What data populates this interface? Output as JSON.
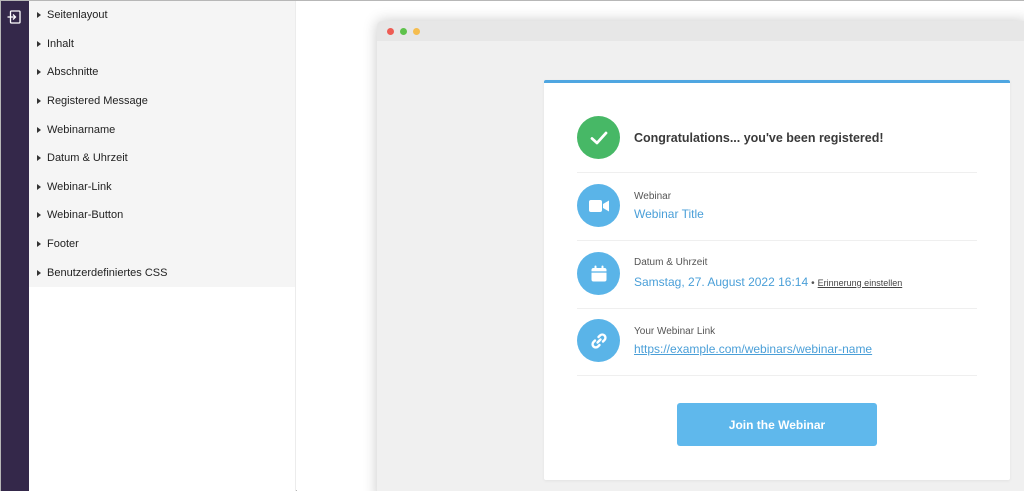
{
  "sidebar": {
    "items": [
      {
        "label": "Seitenlayout"
      },
      {
        "label": "Inhalt"
      },
      {
        "label": "Abschnitte"
      },
      {
        "label": "Registered Message"
      },
      {
        "label": "Webinarname"
      },
      {
        "label": "Datum & Uhrzeit"
      },
      {
        "label": "Webinar-Link"
      },
      {
        "label": "Webinar-Button"
      },
      {
        "label": "Footer"
      },
      {
        "label": "Benutzerdefiniertes CSS"
      }
    ]
  },
  "preview": {
    "confirmation": {
      "headline": "Congratulations... you've been registered!",
      "icon": "check-icon"
    },
    "webinar": {
      "label": "Webinar",
      "value": "Webinar Title",
      "icon": "video-camera-icon"
    },
    "datetime": {
      "label": "Datum & Uhrzeit",
      "value": "Samstag, 27. August 2022 16:14",
      "separator": "•",
      "reminder": "Erinnerung einstellen",
      "icon": "calendar-icon"
    },
    "link": {
      "label": "Your Webinar Link",
      "value": "https://example.com/webinars/webinar-name",
      "icon": "link-icon"
    },
    "join_button": {
      "label": "Join the Webinar"
    }
  },
  "colors": {
    "rail": "#34284a",
    "accent": "#4fa6e1",
    "success": "#47b866",
    "button": "#5fb8ec",
    "dot_red": "#ee5c54",
    "dot_yellow": "#f5bd4f",
    "dot_green": "#5ec24b"
  }
}
